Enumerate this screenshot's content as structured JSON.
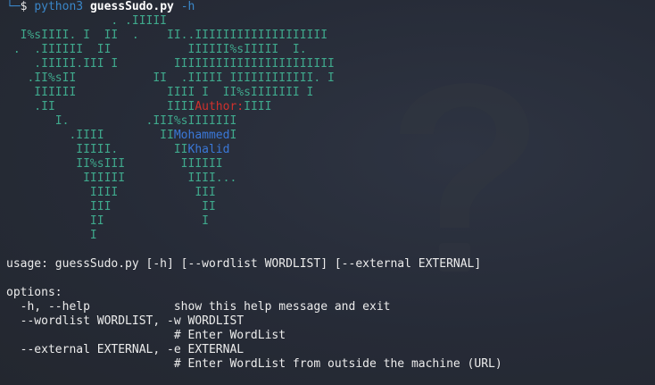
{
  "prompt": {
    "corner": "└─",
    "symbol": "$",
    "python": "python3",
    "file": "guessSudo.py",
    "arg": "-h"
  },
  "banner_lines": [
    "               . .IIIII",
    "  I%sIIII. I  II  .    II..IIIIIIIIIIIIIIIIIII",
    " .  .IIIIII  II           IIIIII%sIIIII  I.",
    "    .IIIII.III I        IIIIIIIIIIIIIIIIIIIIIII",
    "   .II%sII           II  .IIIII IIIIIIIIIIII. I",
    "    IIIIII             IIII I  II%sIIIIIII I",
    "    .II                IIII",
    "       I.           .III%sIIIIIII",
    "         .IIII        II",
    "          IIIII.        II",
    "          II%sIII        IIIIII",
    "           IIIIII         IIII...",
    "            IIII           III",
    "            III             II",
    "            II              I",
    "            I"
  ],
  "banner_overlays": {
    "author_label": "Author:",
    "author_tail": "IIII",
    "name_first": "Mohammed",
    "name_first_tail": "I",
    "name_last": "Khalid"
  },
  "usage": "usage: guessSudo.py [-h] [--wordlist WORDLIST] [--external EXTERNAL]",
  "options_header": "options:",
  "options": [
    "  -h, --help            show this help message and exit",
    "  --wordlist WORDLIST, -w WORDLIST",
    "                        # Enter WordList",
    "  --external EXTERNAL, -e EXTERNAL",
    "                        # Enter WordList from outside the machine (URL)"
  ],
  "colors": {
    "background": "#262b37",
    "banner": "#3fa88c",
    "author": "#d0312d",
    "name": "#3a78d8",
    "prompt_blue": "#3a86c8"
  },
  "watermark_icon": "question-mark-watermark"
}
